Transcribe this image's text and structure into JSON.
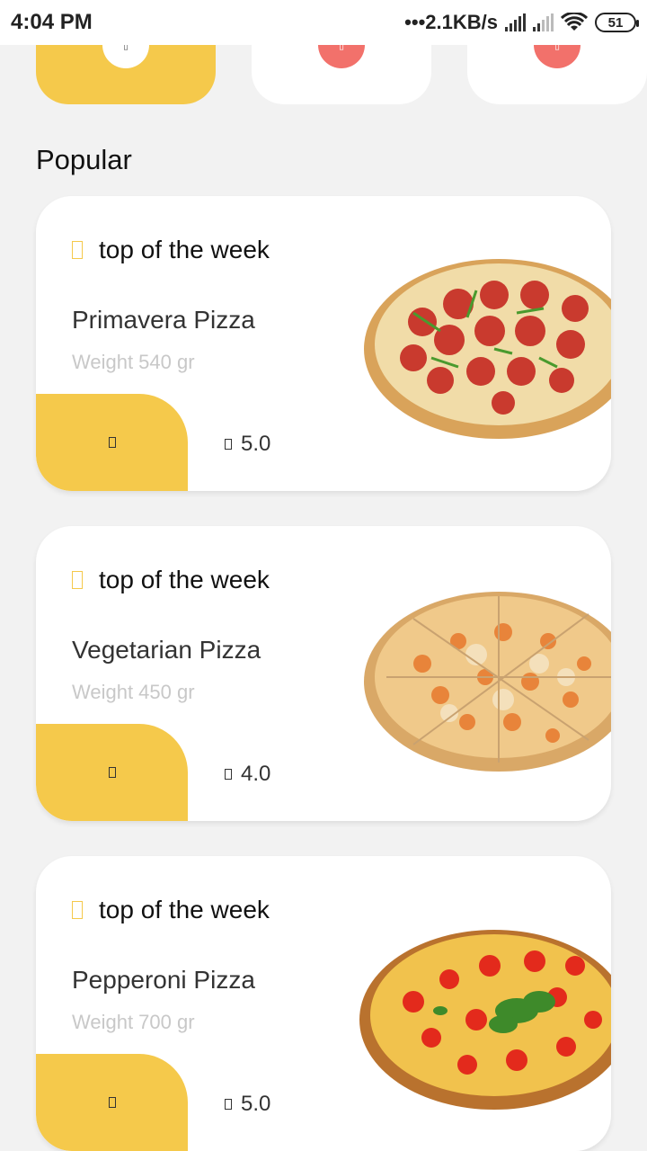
{
  "status_bar": {
    "time": "4:04 PM",
    "network_speed": "2.1KB/s",
    "battery": "51"
  },
  "categories": [
    {
      "active": true
    },
    {
      "active": false
    },
    {
      "active": false
    }
  ],
  "section_title": "Popular",
  "cards": [
    {
      "tag": "top of the week",
      "title": "Primavera Pizza",
      "weight": "Weight 540 gr",
      "rating": "5.0",
      "pizza_style": "pepperoni-salami"
    },
    {
      "tag": "top of the week",
      "title": "Vegetarian Pizza",
      "weight": "Weight 450 gr",
      "rating": "4.0",
      "pizza_style": "vegetarian"
    },
    {
      "tag": "top of the week",
      "title": "Pepperoni Pizza",
      "weight": "Weight 700 gr",
      "rating": "5.0",
      "pizza_style": "tomato-basil"
    }
  ],
  "colors": {
    "accent": "#f5c94b",
    "category_icon": "#f2716b",
    "background": "#f2f2f2"
  }
}
